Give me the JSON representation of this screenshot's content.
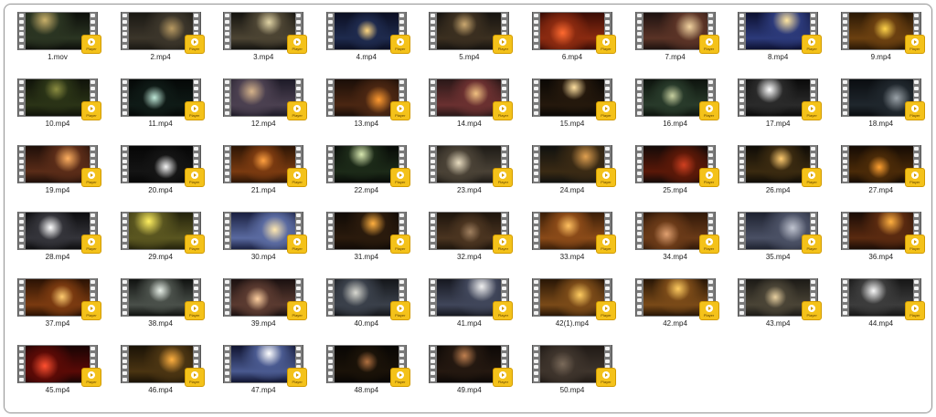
{
  "badge_text": "Player",
  "badge_color": "#f4c21a",
  "files": [
    {
      "name": "1.mov",
      "scene": [
        "#0c0e0a",
        "#2b3522",
        "#c9b06a"
      ]
    },
    {
      "name": "2.mp4",
      "scene": [
        "#1a1813",
        "#3b352a",
        "#b89a62"
      ]
    },
    {
      "name": "3.mp4",
      "scene": [
        "#14130f",
        "#4c4433",
        "#e0d3a5"
      ]
    },
    {
      "name": "4.mp4",
      "scene": [
        "#0b0f22",
        "#1e2a4d",
        "#ffd780"
      ]
    },
    {
      "name": "5.mp4",
      "scene": [
        "#161310",
        "#3b2f20",
        "#caa870"
      ]
    },
    {
      "name": "6.mp4",
      "scene": [
        "#3a0c05",
        "#8a2a10",
        "#ff6a30"
      ]
    },
    {
      "name": "7.mp4",
      "scene": [
        "#1d1210",
        "#5a3326",
        "#f2d3a0"
      ]
    },
    {
      "name": "8.mp4",
      "scene": [
        "#0c1030",
        "#2c3a7a",
        "#ffe6a0"
      ]
    },
    {
      "name": "9.mp4",
      "scene": [
        "#2a1805",
        "#6b4010",
        "#ffd34a"
      ]
    },
    {
      "name": "10.mp4",
      "scene": [
        "#10130a",
        "#2a3316",
        "#8a8c40"
      ]
    },
    {
      "name": "11.mp4",
      "scene": [
        "#050807",
        "#0f1a16",
        "#bfe8d8"
      ]
    },
    {
      "name": "12.mp4",
      "scene": [
        "#1d1a27",
        "#4b4050",
        "#d6b38a"
      ]
    },
    {
      "name": "13.mp4",
      "scene": [
        "#1a0e08",
        "#4a2612",
        "#ff9a30"
      ]
    },
    {
      "name": "14.mp4",
      "scene": [
        "#2a1818",
        "#6a3030",
        "#f0c080"
      ]
    },
    {
      "name": "15.mp4",
      "scene": [
        "#0b0805",
        "#24180c",
        "#ffe0a0"
      ]
    },
    {
      "name": "16.mp4",
      "scene": [
        "#0d130d",
        "#283a2a",
        "#c8d0a0"
      ]
    },
    {
      "name": "17.mp4",
      "scene": [
        "#0a0a0a",
        "#2a2a2a",
        "#ffffff"
      ]
    },
    {
      "name": "18.mp4",
      "scene": [
        "#0a0d10",
        "#1f262c",
        "#9aa2a8"
      ]
    },
    {
      "name": "19.mp4",
      "scene": [
        "#1e0e08",
        "#5a2c18",
        "#ffb060"
      ]
    },
    {
      "name": "20.mp4",
      "scene": [
        "#060606",
        "#141414",
        "#f4f4f4"
      ]
    },
    {
      "name": "21.mp4",
      "scene": [
        "#2c1505",
        "#7a3a10",
        "#ffa040"
      ]
    },
    {
      "name": "22.mp4",
      "scene": [
        "#070a07",
        "#1c2a18",
        "#d8e8b0"
      ]
    },
    {
      "name": "23.mp4",
      "scene": [
        "#1d1a16",
        "#4a4236",
        "#e8dcc0"
      ]
    },
    {
      "name": "24.mp4",
      "scene": [
        "#10110f",
        "#3a2a14",
        "#e0a050"
      ]
    },
    {
      "name": "25.mp4",
      "scene": [
        "#140a08",
        "#5a1808",
        "#d04020"
      ]
    },
    {
      "name": "26.mp4",
      "scene": [
        "#0e0b06",
        "#3a2a10",
        "#ffcc70"
      ]
    },
    {
      "name": "27.mp4",
      "scene": [
        "#150b04",
        "#4a2a08",
        "#ffa030"
      ]
    },
    {
      "name": "28.mp4",
      "scene": [
        "#0d0d0f",
        "#34343a",
        "#ffffff"
      ]
    },
    {
      "name": "29.mp4",
      "scene": [
        "#23220c",
        "#5a5620",
        "#fff060"
      ]
    },
    {
      "name": "30.mp4",
      "scene": [
        "#1a2040",
        "#5a6aa0",
        "#ffe8b0"
      ]
    },
    {
      "name": "31.mp4",
      "scene": [
        "#100a06",
        "#2a1a0c",
        "#ffb040"
      ]
    },
    {
      "name": "32.mp4",
      "scene": [
        "#1d140c",
        "#4a3420",
        "#a08060"
      ]
    },
    {
      "name": "33.mp4",
      "scene": [
        "#3a1e08",
        "#8a4a18",
        "#ffc060"
      ]
    },
    {
      "name": "34.mp4",
      "scene": [
        "#301808",
        "#6a3a18",
        "#e0a070"
      ]
    },
    {
      "name": "35.mp4",
      "scene": [
        "#1e2230",
        "#4a5064",
        "#c0c4d0"
      ]
    },
    {
      "name": "36.mp4",
      "scene": [
        "#1a0c06",
        "#5a2a10",
        "#ffb040"
      ]
    },
    {
      "name": "37.mp4",
      "scene": [
        "#2a1204",
        "#7a3a10",
        "#ffcc70"
      ]
    },
    {
      "name": "38.mp4",
      "scene": [
        "#101210",
        "#4a504a",
        "#e8f0e8"
      ]
    },
    {
      "name": "39.mp4",
      "scene": [
        "#1a1010",
        "#5a3a30",
        "#ffd0a0"
      ]
    },
    {
      "name": "40.mp4",
      "scene": [
        "#14161a",
        "#3a404a",
        "#d8d8d0"
      ]
    },
    {
      "name": "41.mp4",
      "scene": [
        "#161820",
        "#40465a",
        "#f0f0f0"
      ]
    },
    {
      "name": "42(1).mp4",
      "scene": [
        "#281606",
        "#7a4a18",
        "#ffcc60"
      ]
    },
    {
      "name": "42.mp4",
      "scene": [
        "#281606",
        "#7a4a18",
        "#ffcc60"
      ]
    },
    {
      "name": "43.mp4",
      "scene": [
        "#1c1a16",
        "#4a4436",
        "#e8d0a0"
      ]
    },
    {
      "name": "44.mp4",
      "scene": [
        "#161616",
        "#3c3c3c",
        "#f8f8f8"
      ]
    },
    {
      "name": "45.mp4",
      "scene": [
        "#180404",
        "#5a0a06",
        "#ff5030"
      ]
    },
    {
      "name": "46.mp4",
      "scene": [
        "#1a1206",
        "#4a3412",
        "#ffb040"
      ]
    },
    {
      "name": "47.mp4",
      "scene": [
        "#101430",
        "#4a5a90",
        "#ffffff"
      ]
    },
    {
      "name": "48.mp4",
      "scene": [
        "#080604",
        "#1a1208",
        "#b07040"
      ]
    },
    {
      "name": "49.mp4",
      "scene": [
        "#0c0806",
        "#241810",
        "#c08050"
      ]
    },
    {
      "name": "50.mp4",
      "scene": [
        "#201a16",
        "#3e342c",
        "#7a6a5a"
      ]
    }
  ]
}
